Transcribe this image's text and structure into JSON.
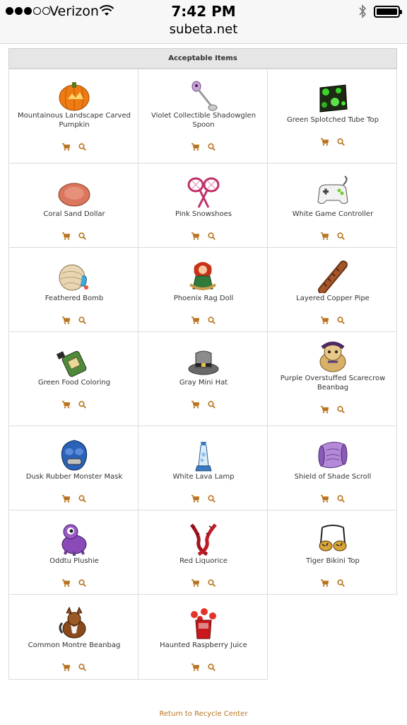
{
  "status_bar": {
    "carrier": "Verizon",
    "time": "7:42 PM",
    "url": "subeta.net"
  },
  "table": {
    "header": "Acceptable Items",
    "items": [
      {
        "name": "Mountainous Landscape Carved Pumpkin",
        "icon": "pumpkin"
      },
      {
        "name": "Violet Collectible Shadowglen Spoon",
        "icon": "spoon"
      },
      {
        "name": "Green Splotched Tube Top",
        "icon": "tube-top"
      },
      {
        "name": "Coral Sand Dollar",
        "icon": "sand-dollar"
      },
      {
        "name": "Pink Snowshoes",
        "icon": "snowshoes"
      },
      {
        "name": "White Game Controller",
        "icon": "game-controller"
      },
      {
        "name": "Feathered Bomb",
        "icon": "feathered-bomb"
      },
      {
        "name": "Phoenix Rag Doll",
        "icon": "rag-doll"
      },
      {
        "name": "Layered Copper Pipe",
        "icon": "copper-pipe"
      },
      {
        "name": "Green Food Coloring",
        "icon": "food-coloring"
      },
      {
        "name": "Gray Mini Hat",
        "icon": "mini-hat"
      },
      {
        "name": "Purple Overstuffed Scarecrow Beanbag",
        "icon": "scarecrow-beanbag"
      },
      {
        "name": "Dusk Rubber Monster Mask",
        "icon": "monster-mask"
      },
      {
        "name": "White Lava Lamp",
        "icon": "lava-lamp"
      },
      {
        "name": "Shield of Shade Scroll",
        "icon": "scroll"
      },
      {
        "name": "Oddtu Plushie",
        "icon": "plushie"
      },
      {
        "name": "Red Liquorice",
        "icon": "liquorice"
      },
      {
        "name": "Tiger Bikini Top",
        "icon": "bikini-top"
      },
      {
        "name": "Common Montre Beanbag",
        "icon": "montre-beanbag"
      },
      {
        "name": "Haunted Raspberry Juice",
        "icon": "raspberry-juice"
      }
    ]
  },
  "footer": {
    "return_link": "Return to Recycle Center"
  },
  "colors": {
    "accent": "#b8741f",
    "header_bg": "#e6e6e6",
    "border": "#dcdcdc"
  }
}
